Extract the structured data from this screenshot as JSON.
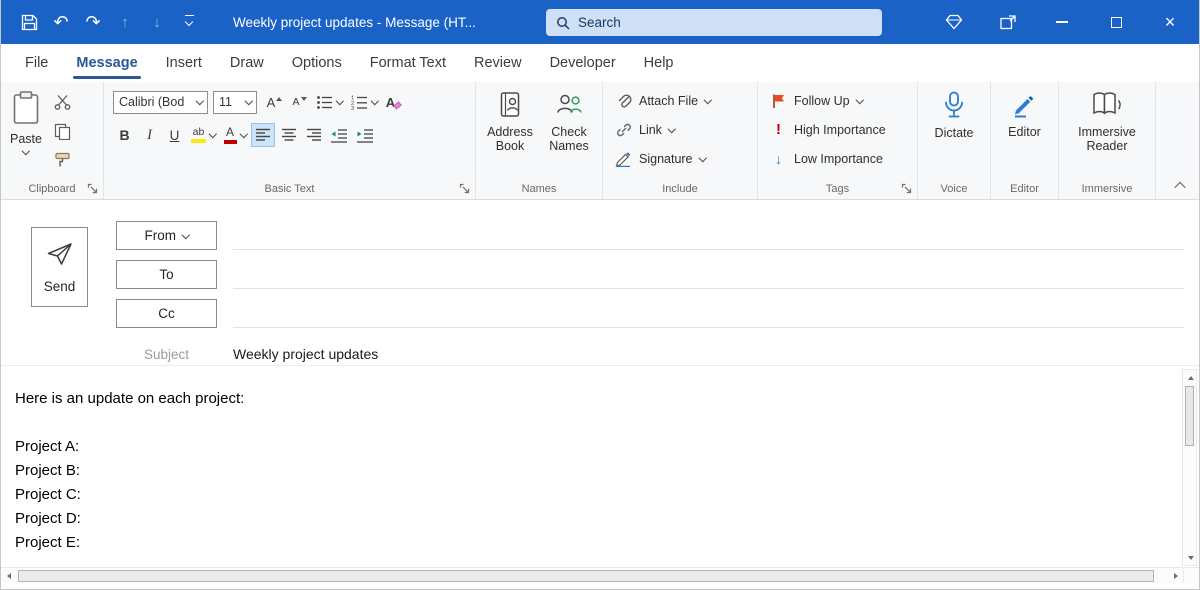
{
  "titlebar": {
    "title": "Weekly project updates  -  Message (HT...",
    "search_placeholder": "Search"
  },
  "tabs": [
    {
      "label": "File"
    },
    {
      "label": "Message",
      "active": true
    },
    {
      "label": "Insert"
    },
    {
      "label": "Draw"
    },
    {
      "label": "Options"
    },
    {
      "label": "Format Text"
    },
    {
      "label": "Review"
    },
    {
      "label": "Developer"
    },
    {
      "label": "Help"
    }
  ],
  "ribbon": {
    "clipboard": {
      "label": "Clipboard",
      "paste": "Paste"
    },
    "basic_text": {
      "label": "Basic Text",
      "font_name": "Calibri (Bod",
      "font_size": "11",
      "grow": "A",
      "shrink": "A",
      "clear": "A",
      "bold": "B",
      "italic": "I",
      "underline": "U",
      "highlight": "ab",
      "font_color": "A"
    },
    "names": {
      "label": "Names",
      "address_book": "Address Book",
      "check_names": "Check Names"
    },
    "include": {
      "label": "Include",
      "attach_file": "Attach File",
      "link": "Link",
      "signature": "Signature"
    },
    "tags": {
      "label": "Tags",
      "follow_up": "Follow Up",
      "high_importance": "High Importance",
      "low_importance": "Low Importance",
      "high_glyph": "!",
      "low_glyph": "↓"
    },
    "voice": {
      "label": "Voice",
      "dictate": "Dictate"
    },
    "editor": {
      "label": "Editor",
      "button": "Editor"
    },
    "immersive": {
      "label": "Immersive",
      "reader": "Immersive Reader"
    }
  },
  "compose": {
    "send": "Send",
    "from": "From",
    "to": "To",
    "cc": "Cc",
    "subject_label": "Subject",
    "subject_value": "Weekly project updates"
  },
  "body": {
    "lines": [
      "Here is an update on each project:",
      "",
      "Project A:",
      "Project B:",
      "Project C:",
      "Project D:",
      "Project E:"
    ]
  },
  "colors": {
    "titlebar": "#1a62c5",
    "accent": "#2b579a",
    "highlight_yellow": "#ffe812",
    "font_color_red": "#c00000",
    "importance_red": "#c00000",
    "importance_blue": "#2b7cd3"
  }
}
